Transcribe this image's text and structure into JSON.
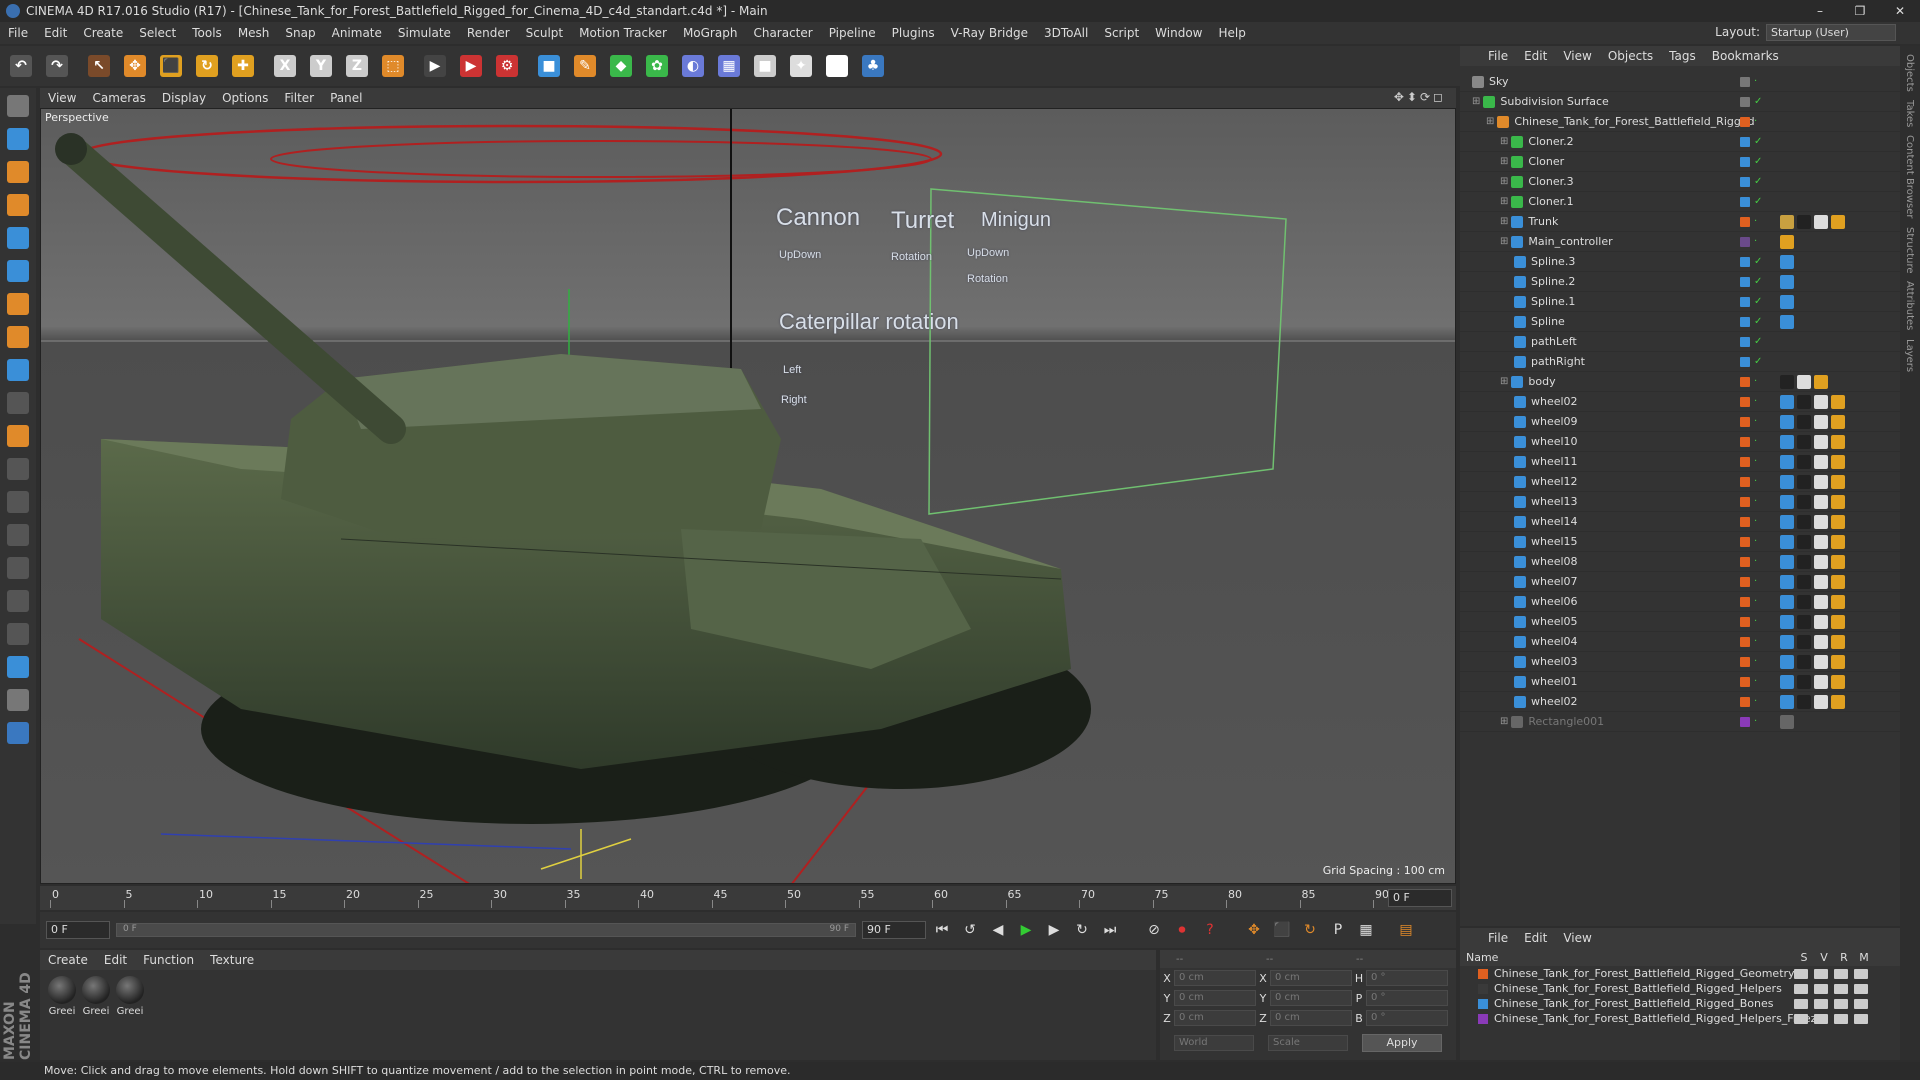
{
  "window": {
    "title": "CINEMA 4D R17.016 Studio (R17) - [Chinese_Tank_for_Forest_Battlefield_Rigged_for_Cinema_4D_c4d_standart.c4d *] - Main",
    "controls": [
      "–",
      "❐",
      "✕"
    ]
  },
  "menu": [
    "File",
    "Edit",
    "Create",
    "Select",
    "Tools",
    "Mesh",
    "Snap",
    "Animate",
    "Simulate",
    "Render",
    "Sculpt",
    "Motion Tracker",
    "MoGraph",
    "Character",
    "Pipeline",
    "Plugins",
    "V-Ray Bridge",
    "3DToAll",
    "Script",
    "Window",
    "Help"
  ],
  "layout": {
    "label": "Layout:",
    "value": "Startup (User)"
  },
  "toolbar": [
    {
      "name": "undo-icon",
      "glyph": "↶",
      "color": "#555"
    },
    {
      "name": "redo-icon",
      "glyph": "↷",
      "color": "#555"
    },
    {
      "name": "live-selection-icon",
      "glyph": "↖",
      "color": "#7a4a2a"
    },
    {
      "name": "move-icon",
      "glyph": "✥",
      "color": "#e08a2a"
    },
    {
      "name": "scale-icon",
      "glyph": "⬛",
      "color": "#e0a020"
    },
    {
      "name": "rotate-icon",
      "glyph": "↻",
      "color": "#e0a020"
    },
    {
      "name": "transform-icon",
      "glyph": "✚",
      "color": "#e0a020"
    },
    {
      "name": "x-axis-icon",
      "glyph": "X",
      "color": "#ccc"
    },
    {
      "name": "y-axis-icon",
      "glyph": "Y",
      "color": "#ccc"
    },
    {
      "name": "z-axis-icon",
      "glyph": "Z",
      "color": "#ccc"
    },
    {
      "name": "world-coordinates-icon",
      "glyph": "⬚",
      "color": "#e08a2a"
    },
    {
      "name": "render-view-icon",
      "glyph": "▶",
      "color": "#444"
    },
    {
      "name": "render-picture-viewer-icon",
      "glyph": "▶",
      "color": "#c33"
    },
    {
      "name": "render-settings-icon",
      "glyph": "⚙",
      "color": "#c33"
    },
    {
      "name": "cube-icon",
      "glyph": "■",
      "color": "#3a8fd8"
    },
    {
      "name": "pen-icon",
      "glyph": "✎",
      "color": "#e08a2a"
    },
    {
      "name": "subdivision-icon",
      "glyph": "◆",
      "color": "#3ab84a"
    },
    {
      "name": "array-icon",
      "glyph": "✿",
      "color": "#3ab84a"
    },
    {
      "name": "deformer-icon",
      "glyph": "◐",
      "color": "#6a7ad8"
    },
    {
      "name": "floor-icon",
      "glyph": "▦",
      "color": "#6a7ad8"
    },
    {
      "name": "camera-icon",
      "glyph": "■",
      "color": "#ccc"
    },
    {
      "name": "light-icon",
      "glyph": "✦",
      "color": "#ddd"
    },
    {
      "name": "script-icon",
      "glyph": "S",
      "color": "#fff"
    },
    {
      "name": "python-icon",
      "glyph": "♣",
      "color": "#3a78c0"
    }
  ],
  "lefttools": [
    {
      "name": "model-mode-icon",
      "color": "#777"
    },
    {
      "name": "object-mode-icon",
      "color": "#3a8fd8"
    },
    {
      "name": "texture-mode-icon",
      "color": "#e08a2a"
    },
    {
      "name": "workplane-mode-icon",
      "color": "#e08a2a"
    },
    {
      "name": "points-mode-icon",
      "color": "#3a8fd8"
    },
    {
      "name": "edges-mode-icon",
      "color": "#3a8fd8"
    },
    {
      "name": "polygons-mode-icon",
      "color": "#e08a2a"
    },
    {
      "name": "axis-mode-icon",
      "color": "#e08a2a"
    },
    {
      "name": "tweak-mode-icon",
      "color": "#3a8fd8"
    },
    {
      "name": "snap-icon",
      "color": "#555"
    },
    {
      "name": "magnet-icon",
      "color": "#e08a2a"
    },
    {
      "name": "sculpt-icon",
      "color": "#555"
    },
    {
      "name": "brush-icon",
      "color": "#555"
    },
    {
      "name": "smooth-brush-icon",
      "color": "#555"
    },
    {
      "name": "pull-brush-icon",
      "color": "#555"
    },
    {
      "name": "grab-brush-icon",
      "color": "#555"
    },
    {
      "name": "inflate-brush-icon",
      "color": "#555"
    },
    {
      "name": "grid-icon",
      "color": "#3a8fd8"
    },
    {
      "name": "lock-icon",
      "color": "#777"
    },
    {
      "name": "python-tool-icon",
      "color": "#3a78c0"
    }
  ],
  "maxon": "MAXON CINEMA 4D",
  "viewport": {
    "menu": [
      "View",
      "Cameras",
      "Display",
      "Options",
      "Filter",
      "Panel"
    ],
    "label": "Perspective",
    "grid_spacing": "Grid Spacing : 100 cm",
    "nav": "✥⬍⟳◻"
  },
  "hud": {
    "titles": [
      "Cannon",
      "Turret",
      "Minigun"
    ],
    "row1": [
      "UpDown",
      "Rotation",
      "UpDown"
    ],
    "row2": "Rotation",
    "section": "Caterpillar rotation",
    "left": "Left",
    "right": "Right"
  },
  "timeline": {
    "ticks": [
      "0",
      "5",
      "10",
      "15",
      "20",
      "25",
      "30",
      "35",
      "40",
      "45",
      "50",
      "55",
      "60",
      "65",
      "70",
      "75",
      "80",
      "85",
      "90"
    ],
    "frame": "0 F"
  },
  "transport": {
    "start": "0 F",
    "slider_left": "0 F",
    "slider_right": "90 F",
    "end": "90 F"
  },
  "material": {
    "menu": [
      "Create",
      "Edit",
      "Function",
      "Texture"
    ],
    "swatches": [
      "Greei",
      "Greei",
      "Greei"
    ]
  },
  "coords": {
    "header": [
      "--",
      "--",
      "--"
    ],
    "rows": [
      {
        "a": "X",
        "v1": "0 cm",
        "b": "X",
        "v2": "0 cm",
        "c": "H",
        "v3": "0 °"
      },
      {
        "a": "Y",
        "v1": "0 cm",
        "b": "Y",
        "v2": "0 cm",
        "c": "P",
        "v3": "0 °"
      },
      {
        "a": "Z",
        "v1": "0 cm",
        "b": "Z",
        "v2": "0 cm",
        "c": "B",
        "v3": "0 °"
      }
    ],
    "world": "World",
    "scale": "Scale",
    "apply": "Apply"
  },
  "objects": {
    "menu": [
      "File",
      "Edit",
      "View",
      "Objects",
      "Tags",
      "Bookmarks"
    ],
    "rows": [
      {
        "name": "Sky",
        "indent": 0,
        "color": "#888",
        "tag": "#777",
        "chk": false,
        "tags": []
      },
      {
        "name": "Subdivision Surface",
        "indent": 0,
        "color": "#3ab84a",
        "tag": "#777",
        "chk": true,
        "tags": []
      },
      {
        "name": "Chinese_Tank_for_Forest_Battlefield_Rigged",
        "indent": 1,
        "color": "#e08a2a",
        "tag": "#e06020",
        "chk": false,
        "tags": []
      },
      {
        "name": "Cloner.2",
        "indent": 2,
        "color": "#3ab84a",
        "tag": "#3a8fd8",
        "chk": true,
        "tags": []
      },
      {
        "name": "Cloner",
        "indent": 2,
        "color": "#3ab84a",
        "tag": "#3a8fd8",
        "chk": true,
        "tags": []
      },
      {
        "name": "Cloner.3",
        "indent": 2,
        "color": "#3ab84a",
        "tag": "#3a8fd8",
        "chk": true,
        "tags": []
      },
      {
        "name": "Cloner.1",
        "indent": 2,
        "color": "#3ab84a",
        "tag": "#3a8fd8",
        "chk": true,
        "tags": []
      },
      {
        "name": "Trunk",
        "indent": 2,
        "color": "#3a8fd8",
        "tag": "#e06020",
        "chk": false,
        "tags": [
          "#c8a040",
          "#222",
          "#ddd",
          "#e0a020"
        ]
      },
      {
        "name": "Main_controller",
        "indent": 2,
        "color": "#3a8fd8",
        "tag": "#6a4a8a",
        "chk": false,
        "tags": [
          "#e0a020"
        ]
      },
      {
        "name": "Spline.3",
        "indent": 3,
        "color": "#3a8fd8",
        "tag": "#3a8fd8",
        "chk": true,
        "tags": [
          "#3a8fd8"
        ]
      },
      {
        "name": "Spline.2",
        "indent": 3,
        "color": "#3a8fd8",
        "tag": "#3a8fd8",
        "chk": true,
        "tags": [
          "#3a8fd8"
        ]
      },
      {
        "name": "Spline.1",
        "indent": 3,
        "color": "#3a8fd8",
        "tag": "#3a8fd8",
        "chk": true,
        "tags": [
          "#3a8fd8"
        ]
      },
      {
        "name": "Spline",
        "indent": 3,
        "color": "#3a8fd8",
        "tag": "#3a8fd8",
        "chk": true,
        "tags": [
          "#3a8fd8"
        ]
      },
      {
        "name": "pathLeft",
        "indent": 3,
        "color": "#3a8fd8",
        "tag": "#3a8fd8",
        "chk": true,
        "tags": []
      },
      {
        "name": "pathRight",
        "indent": 3,
        "color": "#3a8fd8",
        "tag": "#3a8fd8",
        "chk": true,
        "tags": []
      },
      {
        "name": "body",
        "indent": 2,
        "color": "#3a8fd8",
        "tag": "#e06020",
        "chk": false,
        "tags": [
          "#222",
          "#ddd",
          "#e0a020"
        ]
      },
      {
        "name": "wheel02",
        "indent": 3,
        "color": "#3a8fd8",
        "tag": "#e06020",
        "chk": false,
        "tags": [
          "#3a8fd8",
          "#222",
          "#ddd",
          "#e0a020"
        ]
      },
      {
        "name": "wheel09",
        "indent": 3,
        "color": "#3a8fd8",
        "tag": "#e06020",
        "chk": false,
        "tags": [
          "#3a8fd8",
          "#222",
          "#ddd",
          "#e0a020"
        ]
      },
      {
        "name": "wheel10",
        "indent": 3,
        "color": "#3a8fd8",
        "tag": "#e06020",
        "chk": false,
        "tags": [
          "#3a8fd8",
          "#222",
          "#ddd",
          "#e0a020"
        ]
      },
      {
        "name": "wheel11",
        "indent": 3,
        "color": "#3a8fd8",
        "tag": "#e06020",
        "chk": false,
        "tags": [
          "#3a8fd8",
          "#222",
          "#ddd",
          "#e0a020"
        ]
      },
      {
        "name": "wheel12",
        "indent": 3,
        "color": "#3a8fd8",
        "tag": "#e06020",
        "chk": false,
        "tags": [
          "#3a8fd8",
          "#222",
          "#ddd",
          "#e0a020"
        ]
      },
      {
        "name": "wheel13",
        "indent": 3,
        "color": "#3a8fd8",
        "tag": "#e06020",
        "chk": false,
        "tags": [
          "#3a8fd8",
          "#222",
          "#ddd",
          "#e0a020"
        ]
      },
      {
        "name": "wheel14",
        "indent": 3,
        "color": "#3a8fd8",
        "tag": "#e06020",
        "chk": false,
        "tags": [
          "#3a8fd8",
          "#222",
          "#ddd",
          "#e0a020"
        ]
      },
      {
        "name": "wheel15",
        "indent": 3,
        "color": "#3a8fd8",
        "tag": "#e06020",
        "chk": false,
        "tags": [
          "#3a8fd8",
          "#222",
          "#ddd",
          "#e0a020"
        ]
      },
      {
        "name": "wheel08",
        "indent": 3,
        "color": "#3a8fd8",
        "tag": "#e06020",
        "chk": false,
        "tags": [
          "#3a8fd8",
          "#222",
          "#ddd",
          "#e0a020"
        ]
      },
      {
        "name": "wheel07",
        "indent": 3,
        "color": "#3a8fd8",
        "tag": "#e06020",
        "chk": false,
        "tags": [
          "#3a8fd8",
          "#222",
          "#ddd",
          "#e0a020"
        ]
      },
      {
        "name": "wheel06",
        "indent": 3,
        "color": "#3a8fd8",
        "tag": "#e06020",
        "chk": false,
        "tags": [
          "#3a8fd8",
          "#222",
          "#ddd",
          "#e0a020"
        ]
      },
      {
        "name": "wheel05",
        "indent": 3,
        "color": "#3a8fd8",
        "tag": "#e06020",
        "chk": false,
        "tags": [
          "#3a8fd8",
          "#222",
          "#ddd",
          "#e0a020"
        ]
      },
      {
        "name": "wheel04",
        "indent": 3,
        "color": "#3a8fd8",
        "tag": "#e06020",
        "chk": false,
        "tags": [
          "#3a8fd8",
          "#222",
          "#ddd",
          "#e0a020"
        ]
      },
      {
        "name": "wheel03",
        "indent": 3,
        "color": "#3a8fd8",
        "tag": "#e06020",
        "chk": false,
        "tags": [
          "#3a8fd8",
          "#222",
          "#ddd",
          "#e0a020"
        ]
      },
      {
        "name": "wheel01",
        "indent": 3,
        "color": "#3a8fd8",
        "tag": "#e06020",
        "chk": false,
        "tags": [
          "#3a8fd8",
          "#222",
          "#ddd",
          "#e0a020"
        ]
      },
      {
        "name": "wheel02",
        "indent": 3,
        "color": "#3a8fd8",
        "tag": "#e06020",
        "chk": false,
        "tags": [
          "#3a8fd8",
          "#222",
          "#ddd",
          "#e0a020"
        ]
      },
      {
        "name": "Rectangle001",
        "indent": 2,
        "color": "#666",
        "tag": "#8a3ab8",
        "chk": false,
        "tags": [
          "#666"
        ]
      }
    ]
  },
  "sidetabs": [
    "Objects",
    "Takes",
    "Content Browser",
    "Structure",
    "Attributes",
    "Layers"
  ],
  "layers": {
    "menu": [
      "File",
      "Edit",
      "View"
    ],
    "header": "Name",
    "cols": [
      "S",
      "V",
      "R",
      "M"
    ],
    "rows": [
      {
        "name": "Chinese_Tank_for_Forest_Battlefield_Rigged_Geometry",
        "color": "#e06020"
      },
      {
        "name": "Chinese_Tank_for_Forest_Battlefield_Rigged_Helpers",
        "color": "#3a3a3a"
      },
      {
        "name": "Chinese_Tank_for_Forest_Battlefield_Rigged_Bones",
        "color": "#3a8fd8"
      },
      {
        "name": "Chinese_Tank_for_Forest_Battlefield_Rigged_Helpers_Freeze",
        "color": "#8a3ab8"
      }
    ]
  },
  "status": "Move: Click and drag to move elements. Hold down SHIFT to quantize movement / add to the selection in point mode, CTRL to remove."
}
